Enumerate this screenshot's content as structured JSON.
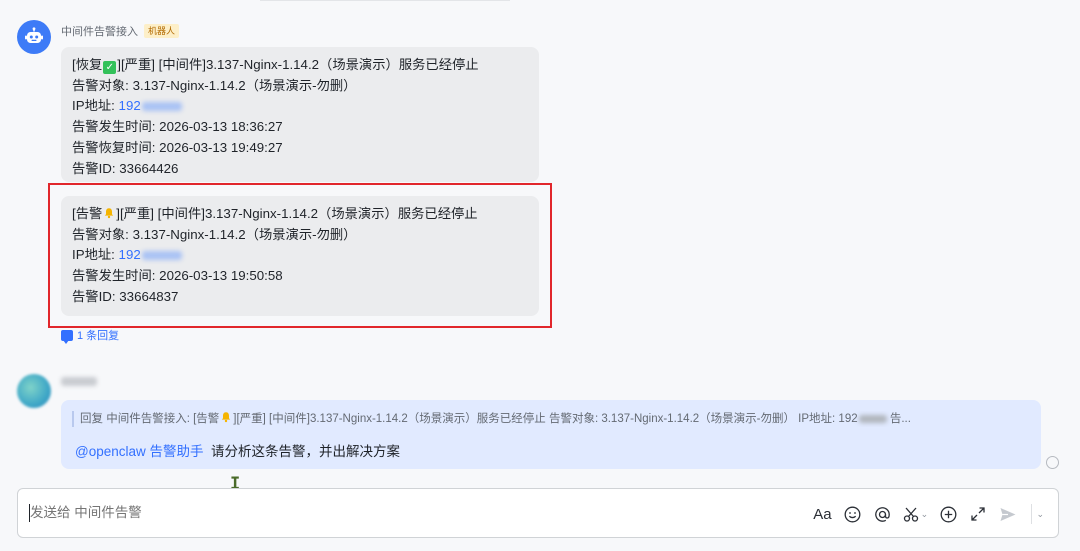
{
  "bot_message": {
    "sender": "中间件告警接入",
    "tag": "机器人",
    "cards": [
      {
        "title_pre": "[恢复",
        "title_post": "][严重] [中间件]3.137-Nginx-1.14.2（场景演示）服务已经停止",
        "object": "告警对象: 3.137-Nginx-1.14.2（场景演示-勿删）",
        "ip_label": "IP地址: ",
        "ip_visible": "192",
        "occur_time": "告警发生时间: 2026-03-13 18:36:27",
        "recover_time": "告警恢复时间: 2026-03-13 19:49:27",
        "alert_id": "告警ID: 33664426"
      },
      {
        "title_pre": "[告警",
        "title_post": "][严重] [中间件]3.137-Nginx-1.14.2（场景演示）服务已经停止",
        "object": "告警对象: 3.137-Nginx-1.14.2（场景演示-勿删）",
        "ip_label": "IP地址: ",
        "ip_visible": "192",
        "occur_time": "告警发生时间: 2026-03-13 19:50:58",
        "alert_id": "告警ID: 33664837"
      }
    ],
    "reply_count": "1 条回复"
  },
  "user_message": {
    "quote_pre": "回复 中间件告警接入: [告警",
    "quote_mid": "][严重] [中间件]3.137-Nginx-1.14.2（场景演示）服务已经停止 告警对象: 3.137-Nginx-1.14.2（场景演示-勿删） IP地址: 192",
    "quote_post": " 告...",
    "mention": "@openclaw 告警助手",
    "text": "请分析这条告警，并出解决方案"
  },
  "composer": {
    "placeholder": "发送给 中间件告警",
    "font_button": "Aa",
    "emoji_icon": "smile-icon",
    "mention_icon": "at-icon",
    "scissors_icon": "scissors-icon",
    "add_icon": "plus-circle-icon",
    "expand_icon": "expand-icon",
    "send_icon": "send-icon"
  },
  "colors": {
    "accent": "#3370ff",
    "highlight_border": "#e1262b",
    "bot_avatar": "#3d7bf7",
    "check_green": "#33c15a",
    "bell_yellow": "#f5b400"
  }
}
